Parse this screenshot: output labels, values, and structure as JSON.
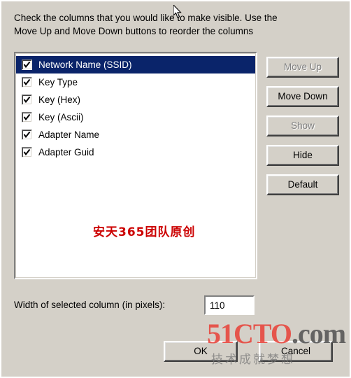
{
  "dialog": {
    "instructions_line1": "Check the columns that you would like to make visible. Use the",
    "instructions_line2": "Move Up and Move Down buttons to reorder the columns"
  },
  "column_list": {
    "items": [
      {
        "label": "Network Name (SSID)",
        "checked": true,
        "selected": true
      },
      {
        "label": "Key Type",
        "checked": true,
        "selected": false
      },
      {
        "label": "Key (Hex)",
        "checked": true,
        "selected": false
      },
      {
        "label": "Key (Ascii)",
        "checked": true,
        "selected": false
      },
      {
        "label": "Adapter Name",
        "checked": true,
        "selected": false
      },
      {
        "label": "Adapter Guid",
        "checked": true,
        "selected": false
      }
    ],
    "watermark": "安天365团队原创"
  },
  "side_buttons": {
    "move_up": "Move Up",
    "move_down": "Move Down",
    "show": "Show",
    "hide": "Hide",
    "default": "Default"
  },
  "width_field": {
    "label": "Width of selected column (in pixels):",
    "value": "110"
  },
  "bottom_buttons": {
    "ok": "OK",
    "cancel": "Cancel"
  },
  "watermark": {
    "site_main": "51CTO",
    "site_dotcom": ".com",
    "tagline": "技术成就梦想"
  },
  "colors": {
    "selection": "#0a246a",
    "face": "#d4d0c8",
    "watermark_red": "#cc0000"
  }
}
